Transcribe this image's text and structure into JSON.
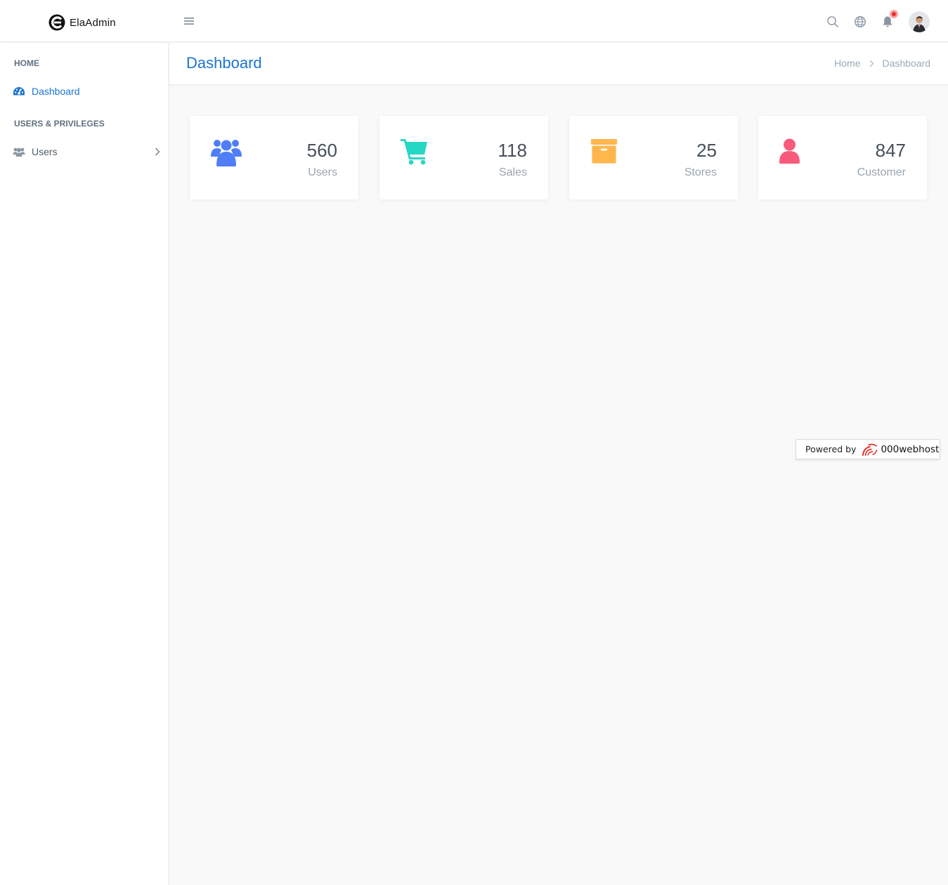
{
  "app": {
    "brand_name": "ElaAdmin"
  },
  "sidebar": {
    "sections": [
      {
        "label": "HOME"
      },
      {
        "label": "USERS & PRIVILEGES"
      }
    ],
    "items": [
      {
        "label": "Dashboard",
        "icon": "dashboard-icon",
        "active": true
      },
      {
        "label": "Users",
        "icon": "users-icon",
        "active": false
      }
    ]
  },
  "header": {
    "icons": [
      "menu-icon",
      "search-icon",
      "globe-icon",
      "bell-icon",
      "avatar"
    ]
  },
  "page": {
    "title": "Dashboard",
    "breadcrumb": {
      "home": "Home",
      "current": "Dashboard"
    }
  },
  "stats": [
    {
      "value": "560",
      "label": "Users",
      "icon": "users-icon",
      "color": "#4f7ef7"
    },
    {
      "value": "118",
      "label": "Sales",
      "icon": "cart-icon",
      "color": "#26d7c5"
    },
    {
      "value": "25",
      "label": "Stores",
      "icon": "archive-box-icon",
      "color": "#ffb64d"
    },
    {
      "value": "847",
      "label": "Customer",
      "icon": "user-icon",
      "color": "#f85a7c"
    }
  ],
  "footer_badge": {
    "prefix": "Powered by",
    "brand": "000webhost"
  },
  "colors": {
    "accent": "#1976d2",
    "background": "#f9f9f9",
    "notification": "#ef2c2c"
  }
}
